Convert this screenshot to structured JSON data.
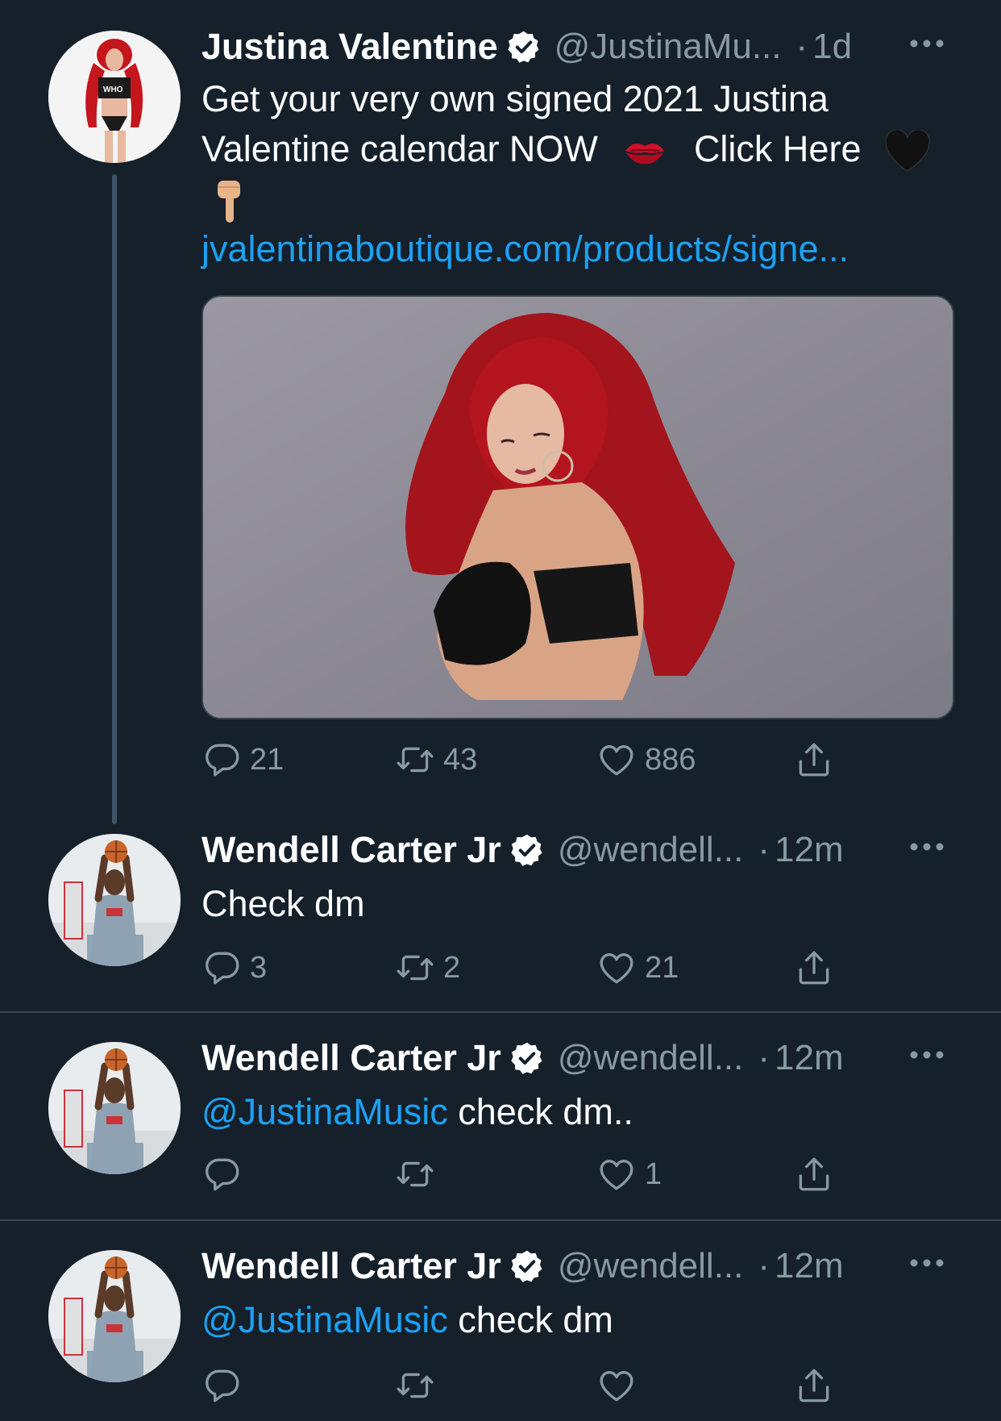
{
  "tweets": [
    {
      "name": "Justina Valentine",
      "handle": "@JustinaMu...",
      "dot": "·",
      "time": "1d",
      "text_line1": "Get your very own signed 2021 Justina",
      "text_line2a": "Valentine calendar NOW",
      "text_line2b": "Click Here",
      "link": "jvalentinaboutique.com/products/signe...",
      "emojis": [
        "kiss-mark-icon",
        "black-heart-icon",
        "pointing-down-icon"
      ],
      "replies": "21",
      "retweets": "43",
      "likes": "886"
    },
    {
      "name": "Wendell Carter Jr",
      "handle": "@wendell...",
      "dot": "·",
      "time": "12m",
      "text": "Check dm",
      "replies": "3",
      "retweets": "2",
      "likes": "21"
    },
    {
      "name": "Wendell Carter Jr",
      "handle": "@wendell...",
      "dot": "·",
      "time": "12m",
      "mention": "@JustinaMusic",
      "text": " check dm..",
      "replies": "",
      "retweets": "",
      "likes": "1"
    },
    {
      "name": "Wendell Carter Jr",
      "handle": "@wendell...",
      "dot": "·",
      "time": "12m",
      "mention": "@JustinaMusic",
      "text": " check dm",
      "replies": "",
      "retweets": "",
      "likes": ""
    }
  ],
  "colors": {
    "background": "#15202b",
    "link": "#1da1f2",
    "muted": "#8899a6",
    "divider": "#38444d"
  }
}
